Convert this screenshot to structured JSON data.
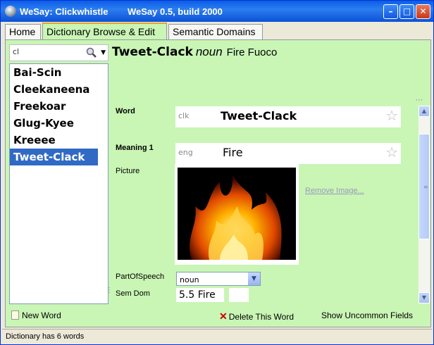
{
  "window": {
    "app": "WeSay: Clickwhistle",
    "build": "WeSay 0.5, build 2000"
  },
  "tabs": [
    {
      "label": "Home"
    },
    {
      "label": "Dictionary Browse & Edit"
    },
    {
      "label": "Semantic Domains"
    }
  ],
  "search": {
    "value": "cl"
  },
  "words": [
    {
      "label": "Bai-Scin"
    },
    {
      "label": "Cleekaneena"
    },
    {
      "label": "Freekoar"
    },
    {
      "label": "Glug-Kyee"
    },
    {
      "label": "Kreeee"
    },
    {
      "label": "Tweet-Clack"
    }
  ],
  "entry": {
    "headword": "Tweet-Clack",
    "pos": "noun",
    "glosses": "Fire Fuoco",
    "word_label": "Word",
    "word_ws": "clk",
    "word_value": "Tweet-Clack",
    "meaning_label": "Meaning 1",
    "meaning_ws": "eng",
    "meaning_value": "Fire",
    "picture_label": "Picture",
    "remove_image": "Remove Image...",
    "pos_label": "PartOfSpeech",
    "pos_value": "noun",
    "semdom_label": "Sem Dom",
    "semdom_value": "5.5 Fire"
  },
  "actions": {
    "new_word": "New Word",
    "delete_word": "Delete This Word",
    "show_uncommon": "Show Uncommon Fields"
  },
  "status": "Dictionary has 6 words"
}
